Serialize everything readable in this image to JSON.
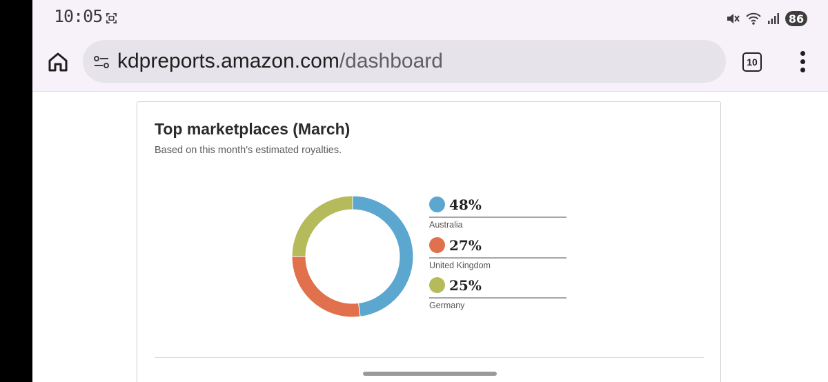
{
  "status_bar": {
    "time": "10:05",
    "battery": "86",
    "icons": [
      "screenshot-icon",
      "mute-icon",
      "wifi-icon",
      "signal-icon",
      "battery-icon"
    ]
  },
  "browser": {
    "url_domain": "kdpreports.amazon.com",
    "url_path": "/dashboard",
    "tab_count": "10",
    "icons": [
      "home-icon",
      "site-info-icon",
      "more-options-icon"
    ]
  },
  "card": {
    "title": "Top marketplaces (March)",
    "subtitle": "Based on this month's estimated royalties."
  },
  "legend": [
    {
      "pct": "48%",
      "label": "Australia",
      "color": "#5ba7d0"
    },
    {
      "pct": "27%",
      "label": "United Kingdom",
      "color": "#e0714c"
    },
    {
      "pct": "25%",
      "label": "Germany",
      "color": "#b5bb5a"
    }
  ],
  "chart_data": {
    "type": "pie",
    "style": "donut",
    "categories": [
      "Australia",
      "United Kingdom",
      "Germany"
    ],
    "values": [
      48,
      27,
      25
    ],
    "colors": [
      "#5ba7d0",
      "#e0714c",
      "#b5bb5a"
    ],
    "title": "Top marketplaces (March)",
    "subtitle": "Based on this month's estimated royalties."
  }
}
